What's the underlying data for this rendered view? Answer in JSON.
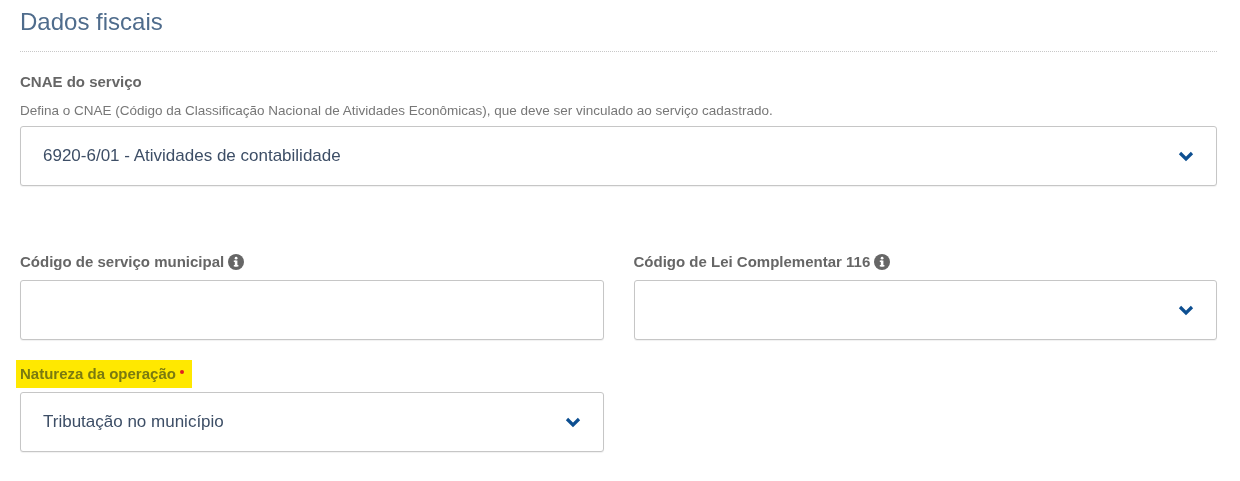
{
  "section": {
    "title": "Dados fiscais"
  },
  "cnae": {
    "label": "CNAE do serviço",
    "description": "Defina o CNAE (Código da Classificação Nacional de Atividades Econômicas), que deve ser vinculado ao serviço cadastrado.",
    "kind": "select",
    "value": "6920-6/01 - Atividades de contabilidade",
    "info": false,
    "required": false,
    "highlighted": false
  },
  "fields": [
    {
      "label": "Código de serviço municipal",
      "kind": "text",
      "info": true,
      "required": false,
      "highlighted": false
    },
    {
      "label": "Código de Lei Complementar 116",
      "kind": "select",
      "info": true,
      "required": false,
      "highlighted": false
    },
    {
      "label": "Natureza da operação",
      "kind": "select",
      "value": "Tributação no município",
      "info": false,
      "required": true,
      "highlighted": true
    }
  ]
}
